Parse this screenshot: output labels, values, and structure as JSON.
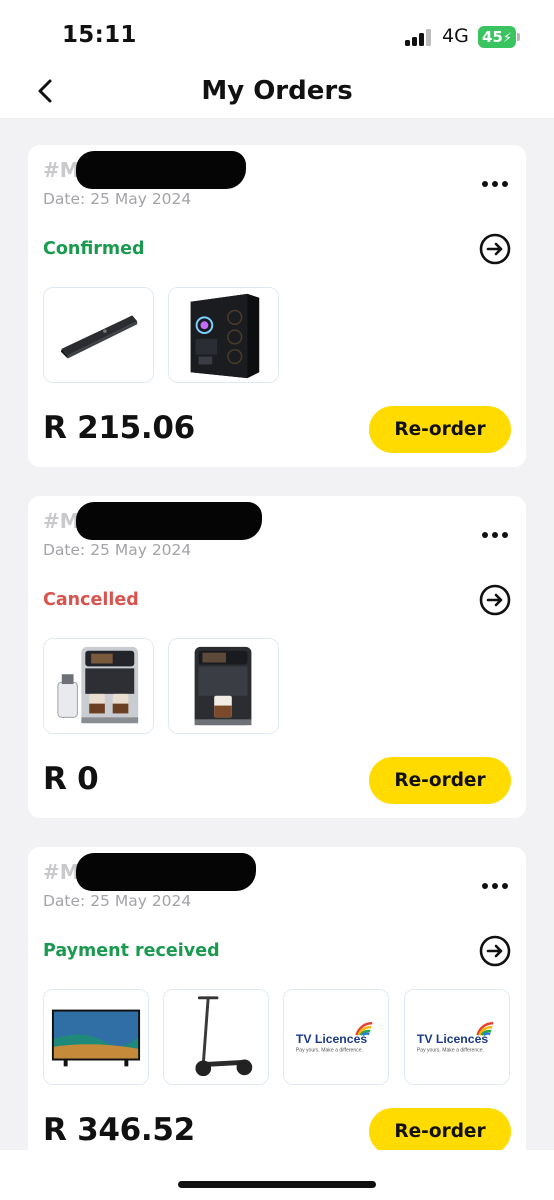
{
  "status_bar": {
    "time": "15:11",
    "network": "4G",
    "battery": "45"
  },
  "header": {
    "title": "My Orders"
  },
  "colors": {
    "accent": "#ffdb00",
    "confirmed": "#1a9a4f",
    "cancelled": "#d9534f",
    "payment_received": "#1a9a4f"
  },
  "orders": [
    {
      "order_id": "#M",
      "date": "Date: 25 May 2024",
      "status": "Confirmed",
      "products": [
        "soundbar",
        "pc-case"
      ],
      "price": "R 215.06",
      "reorder_label": "Re-order"
    },
    {
      "order_id": "#M",
      "date": "Date: 25 May 2024",
      "status": "Cancelled",
      "products": [
        "coffee-machine-with-milk-jug",
        "coffee-machine"
      ],
      "price": "R 0",
      "reorder_label": "Re-order"
    },
    {
      "order_id": "#M",
      "date": "Date: 25 May 2024",
      "status": "Payment received",
      "products": [
        "television",
        "electric-scooter",
        "tv-licences-logo",
        "tv-licences-logo"
      ],
      "price": "R 346.52",
      "reorder_label": "Re-order",
      "tv_licence_name": "TV Licences",
      "tv_licence_tagline": "Pay yours. Make a difference."
    }
  ]
}
